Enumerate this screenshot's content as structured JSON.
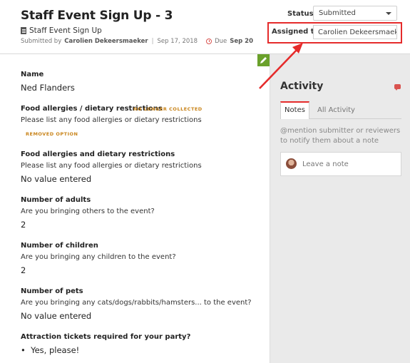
{
  "header": {
    "title": "Staff Event Sign Up - 3",
    "form_name": "Staff Event Sign Up",
    "submitted_by_label": "Submitted by",
    "submitter": "Carolien Dekeersmaeker",
    "submitted_date": "Sep 17, 2018",
    "due_label": "Due",
    "due_date": "Sep 20"
  },
  "status": {
    "label": "Status",
    "value": "Submitted"
  },
  "assigned": {
    "label": "Assigned to",
    "value": "Carolien Dekeersmaeker"
  },
  "fields": {
    "name": {
      "label": "Name",
      "value": "Ned Flanders"
    },
    "food_old": {
      "label": "Food allergies / dietary restrictions",
      "badge": "NO LONGER COLLECTED",
      "desc": "Please list any food allergies or dietary restrictions",
      "value_badge": "REMOVED OPTION"
    },
    "food_new": {
      "label": "Food allergies and dietary restrictions",
      "desc": "Please list any food allergies or dietary restrictions",
      "value": "No value entered"
    },
    "adults": {
      "label": "Number of adults",
      "desc": "Are you bringing others to the event?",
      "value": "2"
    },
    "children": {
      "label": "Number of children",
      "desc": "Are you bringing any children to the event?",
      "value": "2"
    },
    "pets": {
      "label": "Number of pets",
      "desc": "Are you bringing any cats/dogs/rabbits/hamsters... to the event?",
      "value": "No value entered"
    },
    "tickets": {
      "label": "Attraction tickets required for your party?",
      "value": "Yes, please!"
    }
  },
  "activity": {
    "title": "Activity",
    "tabs": [
      "Notes",
      "All Activity"
    ],
    "hint": "@mention submitter or reviewers to notify them about a note",
    "note_placeholder": "Leave a note"
  },
  "colors": {
    "highlight": "#e52b2b",
    "edit_button": "#6aa12b",
    "badge": "#c9841a",
    "sidebar_bg": "#eaeaea"
  },
  "icons": [
    "document-icon",
    "clock-icon",
    "caret-down-icon",
    "pencil-icon",
    "chat-icon",
    "annotation-arrow"
  ]
}
